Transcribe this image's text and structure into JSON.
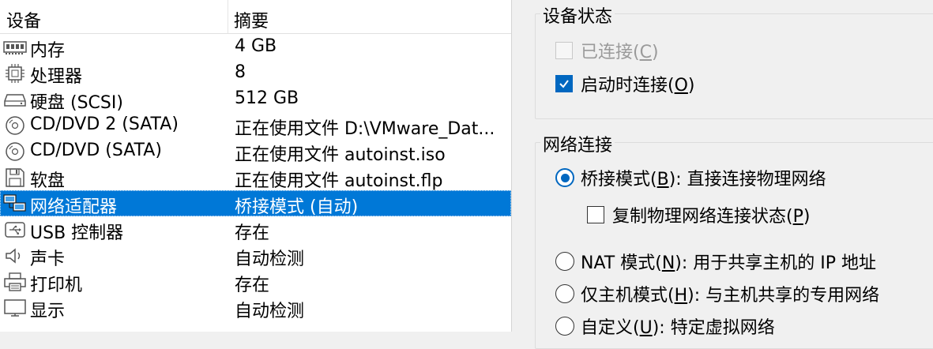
{
  "device_list": {
    "col_device": "设备",
    "col_summary": "摘要",
    "rows": [
      {
        "icon": "memory-icon",
        "name": "内存",
        "summary": "4 GB"
      },
      {
        "icon": "processor-icon",
        "name": "处理器",
        "summary": "8"
      },
      {
        "icon": "hard-disk-icon",
        "name": "硬盘 (SCSI)",
        "summary": "512 GB"
      },
      {
        "icon": "cd-dvd-icon",
        "name": "CD/DVD 2 (SATA)",
        "summary": "正在使用文件 D:\\VMware_Dat..."
      },
      {
        "icon": "cd-dvd-icon",
        "name": "CD/DVD (SATA)",
        "summary": "正在使用文件 autoinst.iso"
      },
      {
        "icon": "floppy-icon",
        "name": "软盘",
        "summary": "正在使用文件 autoinst.flp"
      },
      {
        "icon": "network-adapter-icon",
        "name": "网络适配器",
        "summary": "桥接模式 (自动)"
      },
      {
        "icon": "usb-icon",
        "name": "USB 控制器",
        "summary": "存在"
      },
      {
        "icon": "sound-icon",
        "name": "声卡",
        "summary": "自动检测"
      },
      {
        "icon": "printer-icon",
        "name": "打印机",
        "summary": "存在"
      },
      {
        "icon": "display-icon",
        "name": "显示",
        "summary": "自动检测"
      }
    ]
  },
  "device_status": {
    "title": "设备状态",
    "connected_label": "已连接(",
    "connected_key": "C",
    "connected_tail": ")",
    "connected_checked": false,
    "connect_on_start_label": "启动时连接(",
    "connect_on_start_key": "O",
    "connect_on_start_tail": ")",
    "connect_on_start_checked": true
  },
  "network": {
    "title": "网络连接",
    "bridged_label": "桥接模式(",
    "bridged_key": "B",
    "bridged_tail": "): 直接连接物理网络",
    "replicate_label": "复制物理网络连接状态(",
    "replicate_key": "P",
    "replicate_tail": ")",
    "nat_label": "NAT 模式(",
    "nat_key": "N",
    "nat_tail": "): 用于共享主机的 IP 地址",
    "hostonly_label": "仅主机模式(",
    "hostonly_key": "H",
    "hostonly_tail": "): 与主机共享的专用网络",
    "custom_label": "自定义(",
    "custom_key": "U",
    "custom_tail": "): 特定虚拟网络",
    "selected": "bridged"
  },
  "colors": {
    "selection": "#0078d7",
    "accent": "#0067c0"
  }
}
